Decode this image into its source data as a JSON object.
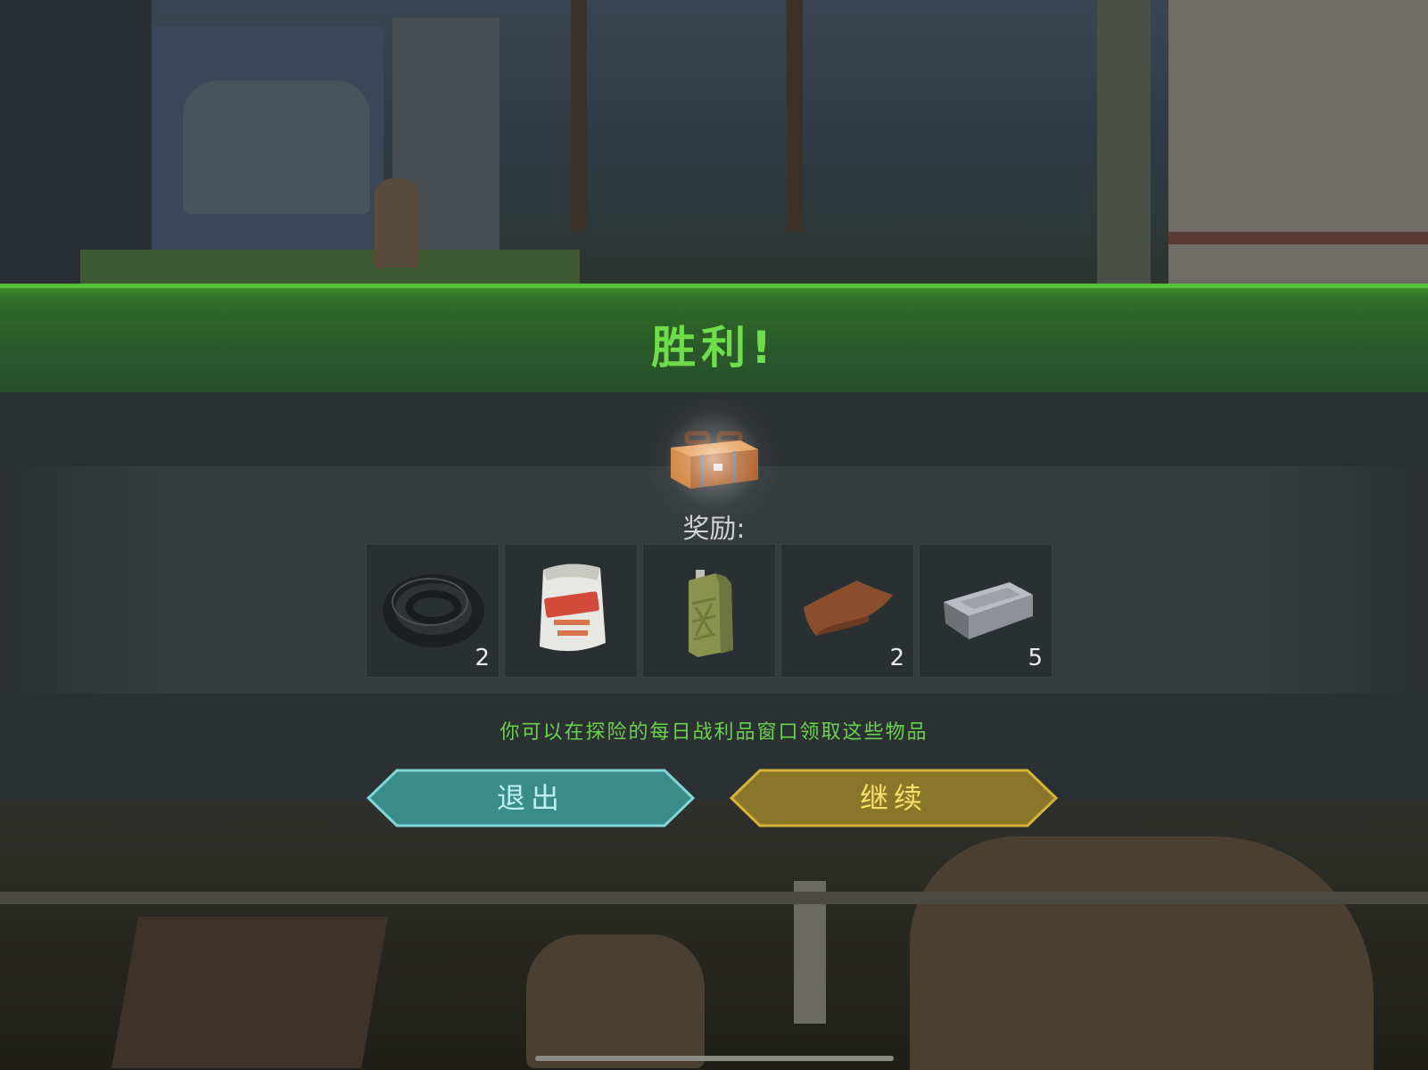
{
  "result": {
    "title": "胜利!"
  },
  "rewards": {
    "label": "奖励:",
    "items": [
      {
        "name": "rubber-hose",
        "quantity": "2"
      },
      {
        "name": "asbestos-bag",
        "quantity": ""
      },
      {
        "name": "jerrycan",
        "quantity": ""
      },
      {
        "name": "leather-piece",
        "quantity": "2"
      },
      {
        "name": "metal-ingot",
        "quantity": "5"
      }
    ],
    "hint": "你可以在探险的每日战利品窗口领取这些物品"
  },
  "buttons": {
    "exit_label": "退出",
    "continue_label": "继续"
  },
  "colors": {
    "accent_green": "#6fdc4a",
    "exit_teal": "#3a8c8a",
    "continue_gold": "#8a7628"
  }
}
